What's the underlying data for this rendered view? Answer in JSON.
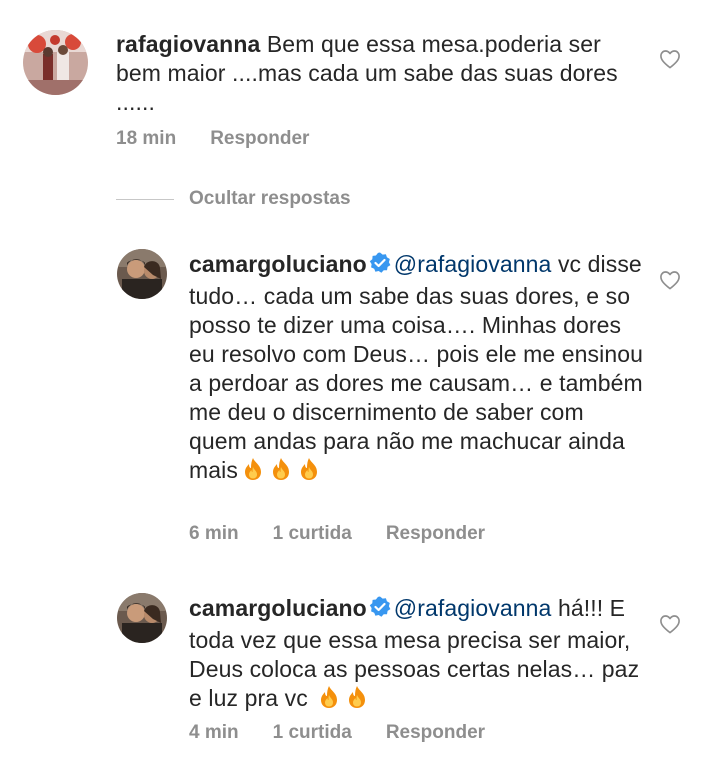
{
  "comments": [
    {
      "username": "rafagiovanna",
      "text": "Bem que essa mesa.poderia ser bem maior ....mas cada um sabe das suas dores ......",
      "time": "18 min",
      "reply_label": "Responder"
    },
    {
      "username": "camargoluciano",
      "mention": "@rafagiovanna",
      "text": "vc disse tudo… cada um sabe das suas dores, e so posso te dizer uma coisa…. Minhas dores eu resolvo com Deus… pois ele me ensinou a perdoar as dores me causam… e também me deu o discernimento de saber com quem andas para não me machucar ainda mais",
      "time": "6 min",
      "likes": "1 curtida",
      "reply_label": "Responder"
    },
    {
      "username": "camargoluciano",
      "mention": "@rafagiovanna",
      "text": "há!!! E toda vez que essa mesa precisa ser maior, Deus coloca as pessoas certas nelas… paz e luz pra vc",
      "time": "4 min",
      "likes": "1 curtida",
      "reply_label": "Responder"
    }
  ],
  "hide_replies_label": "Ocultar respostas",
  "colors": {
    "text": "#262626",
    "meta": "#8e8e8e",
    "mention": "#00376b",
    "verified": "#3897f0"
  },
  "icons": [
    "heart-outline-icon",
    "verified-badge-icon",
    "fire-emoji-icon"
  ]
}
